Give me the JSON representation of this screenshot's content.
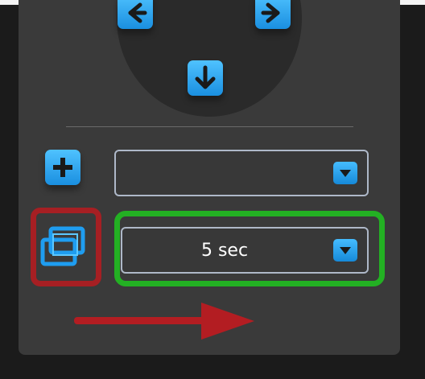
{
  "dpad": {
    "left_icon": "arrow-left-icon",
    "right_icon": "arrow-right-icon",
    "down_icon": "arrow-down-icon"
  },
  "controls": {
    "add_icon": "plus-icon",
    "first_select_value": "",
    "first_select_caret_icon": "chevron-down-icon",
    "duration_select_value": "5 sec",
    "duration_select_caret_icon": "chevron-down-icon",
    "fit_icon": "fit-screen-icon"
  },
  "annotations": {
    "red_color": "#a61f23",
    "green_color": "#23b023",
    "arrow_icon": "red-arrow-right-icon"
  },
  "colors": {
    "accent": "#1a8fe0",
    "panel": "#3a3a3a",
    "background": "#1b1b1b"
  }
}
